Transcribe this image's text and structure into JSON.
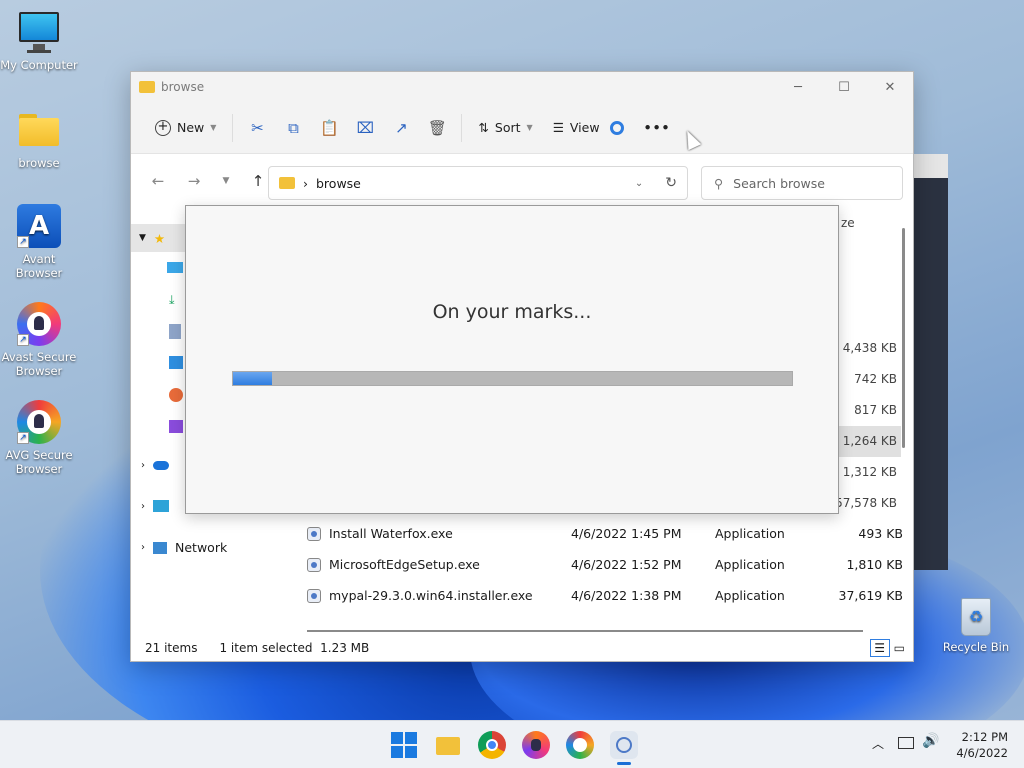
{
  "desktop": {
    "icons": [
      {
        "label": "My Computer"
      },
      {
        "label": "browse"
      },
      {
        "label": "Avant Browser"
      },
      {
        "label": "Avast Secure Browser"
      },
      {
        "label": "AVG Secure Browser"
      }
    ],
    "recycle_bin": "Recycle Bin"
  },
  "explorer": {
    "title": "browse",
    "toolbar": {
      "new": "New",
      "sort": "Sort",
      "view": "View",
      "more": "•••"
    },
    "address": {
      "path": "browse"
    },
    "search": {
      "placeholder": "Search browse"
    },
    "column_size_fragment": "ze",
    "sidebar": {
      "network": "Network"
    },
    "sizes_behind_dialog": [
      "4,438 KB",
      "742 KB",
      "817 KB",
      "1,264 KB",
      "1,312 KB",
      "57,578 KB"
    ],
    "files": [
      {
        "name": "Install Waterfox.exe",
        "date": "4/6/2022 1:45 PM",
        "type": "Application",
        "size": "493 KB"
      },
      {
        "name": "MicrosoftEdgeSetup.exe",
        "date": "4/6/2022 1:52 PM",
        "type": "Application",
        "size": "1,810 KB"
      },
      {
        "name": "mypal-29.3.0.win64.installer.exe",
        "date": "4/6/2022 1:38 PM",
        "type": "Application",
        "size": "37,619 KB"
      }
    ],
    "status": {
      "items": "21 items",
      "selected": "1 item selected",
      "selected_size": "1.23 MB"
    }
  },
  "dialog": {
    "message": "On your marks...",
    "progress": 0.07
  },
  "taskbar": {
    "time": "2:12 PM",
    "date": "4/6/2022"
  }
}
